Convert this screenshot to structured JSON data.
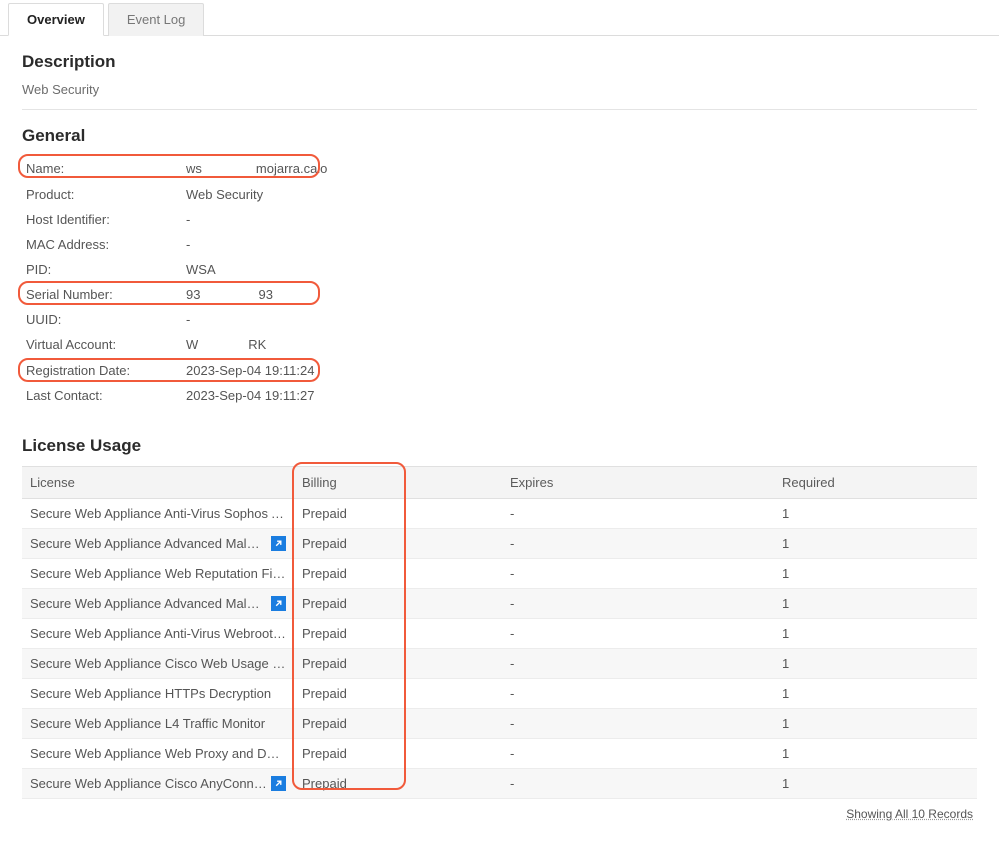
{
  "tabs": {
    "overview": "Overview",
    "eventlog": "Event Log"
  },
  "description": {
    "title": "Description",
    "value": "Web Security"
  },
  "general": {
    "title": "General",
    "name_label": "Name:",
    "name_pre": "ws",
    "name_post": "mojarra.calo",
    "product_label": "Product:",
    "product_value": "Web Security",
    "host_label": "Host Identifier:",
    "host_value": "-",
    "mac_label": "MAC Address:",
    "mac_value": "-",
    "pid_label": "PID:",
    "pid_value": "WSA",
    "serial_label": "Serial Number:",
    "serial_pre": "93",
    "serial_post": "93",
    "uuid_label": "UUID:",
    "uuid_value": "-",
    "va_label": "Virtual Account:",
    "va_pre": "W",
    "va_post": "RK",
    "reg_label": "Registration Date:",
    "reg_value": "2023-Sep-04 19:11:24",
    "last_label": "Last Contact:",
    "last_value": "2023-Sep-04 19:11:27"
  },
  "license": {
    "title": "License Usage",
    "headers": {
      "license": "License",
      "billing": "Billing",
      "expires": "Expires",
      "required": "Required"
    },
    "rows": [
      {
        "name": "Secure Web Appliance Anti-Virus Sophos Add On",
        "link": false,
        "billing": "Prepaid",
        "expires": "-",
        "required": "1"
      },
      {
        "name": "Secure Web Appliance Advanced Malware Protecti…",
        "link": true,
        "billing": "Prepaid",
        "expires": "-",
        "required": "1"
      },
      {
        "name": "Secure Web Appliance Web Reputation Filters",
        "link": false,
        "billing": "Prepaid",
        "expires": "-",
        "required": "1"
      },
      {
        "name": "Secure Web Appliance Advanced Malware Protecti…",
        "link": true,
        "billing": "Prepaid",
        "expires": "-",
        "required": "1"
      },
      {
        "name": "Secure Web Appliance Anti-Virus Webroot Add On",
        "link": false,
        "billing": "Prepaid",
        "expires": "-",
        "required": "1"
      },
      {
        "name": "Secure Web Appliance Cisco Web Usage Controls",
        "link": false,
        "billing": "Prepaid",
        "expires": "-",
        "required": "1"
      },
      {
        "name": "Secure Web Appliance HTTPs Decryption",
        "link": false,
        "billing": "Prepaid",
        "expires": "-",
        "required": "1"
      },
      {
        "name": "Secure Web Appliance L4 Traffic Monitor",
        "link": false,
        "billing": "Prepaid",
        "expires": "-",
        "required": "1"
      },
      {
        "name": "Secure Web Appliance Web Proxy and DVS Engine",
        "link": false,
        "billing": "Prepaid",
        "expires": "-",
        "required": "1"
      },
      {
        "name": "Secure Web Appliance Cisco AnyConnect SM for A…",
        "link": true,
        "billing": "Prepaid",
        "expires": "-",
        "required": "1"
      }
    ],
    "footer": "Showing All 10 Records"
  }
}
